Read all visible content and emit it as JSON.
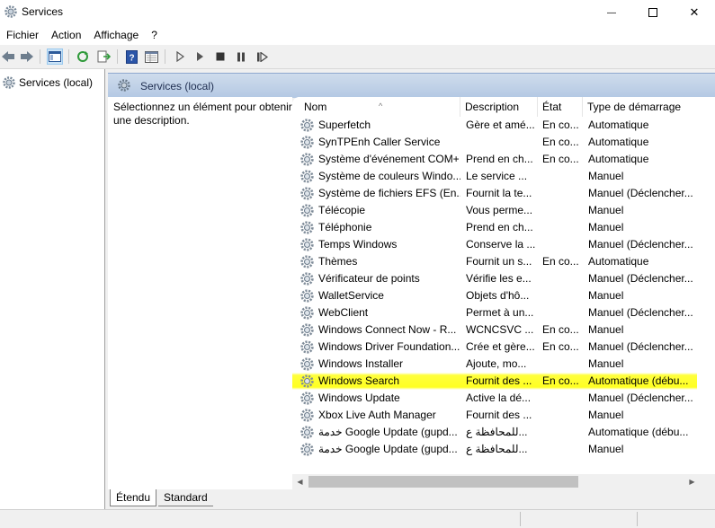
{
  "window": {
    "title": "Services",
    "minimize_glyph": "—",
    "close_glyph": "✕"
  },
  "menu": {
    "items": [
      "Fichier",
      "Action",
      "Affichage",
      "?"
    ]
  },
  "tree": {
    "root_label": "Services (local)"
  },
  "pane": {
    "header_title": "Services (local)",
    "description": "Sélectionnez un élément pour obtenir une description."
  },
  "columns": {
    "name": "Nom",
    "description": "Description",
    "state": "État",
    "startup": "Type de démarrage"
  },
  "services": [
    {
      "name": "Superfetch",
      "description": "Gère et amé...",
      "state": "En co...",
      "startup": "Automatique"
    },
    {
      "name": "SynTPEnh Caller Service",
      "description": "",
      "state": "En co...",
      "startup": "Automatique"
    },
    {
      "name": "Système d'événement COM+",
      "description": "Prend en ch...",
      "state": "En co...",
      "startup": "Automatique"
    },
    {
      "name": "Système de couleurs Windo...",
      "description": "Le service ...",
      "state": "",
      "startup": "Manuel"
    },
    {
      "name": "Système de fichiers EFS (En...",
      "description": "Fournit la te...",
      "state": "",
      "startup": "Manuel (Déclencher..."
    },
    {
      "name": "Télécopie",
      "description": "Vous perme...",
      "state": "",
      "startup": "Manuel"
    },
    {
      "name": "Téléphonie",
      "description": "Prend en ch...",
      "state": "",
      "startup": "Manuel"
    },
    {
      "name": "Temps Windows",
      "description": "Conserve la ...",
      "state": "",
      "startup": "Manuel (Déclencher..."
    },
    {
      "name": "Thèmes",
      "description": "Fournit un s...",
      "state": "En co...",
      "startup": "Automatique"
    },
    {
      "name": "Vérificateur de points",
      "description": "Vérifie les e...",
      "state": "",
      "startup": "Manuel (Déclencher..."
    },
    {
      "name": "WalletService",
      "description": "Objets d'hô...",
      "state": "",
      "startup": "Manuel"
    },
    {
      "name": "WebClient",
      "description": "Permet à un...",
      "state": "",
      "startup": "Manuel (Déclencher..."
    },
    {
      "name": "Windows Connect Now - R...",
      "description": "WCNCSVC ...",
      "state": "En co...",
      "startup": "Manuel"
    },
    {
      "name": "Windows Driver Foundation...",
      "description": "Crée et gère...",
      "state": "En co...",
      "startup": "Manuel (Déclencher..."
    },
    {
      "name": "Windows Installer",
      "description": "Ajoute, mo...",
      "state": "",
      "startup": "Manuel"
    },
    {
      "name": "Windows Search",
      "description": "Fournit des ...",
      "state": "En co...",
      "startup": "Automatique (débu...",
      "highlighted": true
    },
    {
      "name": "Windows Update",
      "description": "Active la dé...",
      "state": "",
      "startup": "Manuel (Déclencher..."
    },
    {
      "name": "Xbox Live Auth Manager",
      "description": "Fournit des ...",
      "state": "",
      "startup": "Manuel"
    },
    {
      "name": "خدمة Google Update (gupd...",
      "description": "للمحافظة ع...",
      "state": "",
      "startup": "Automatique (débu..."
    },
    {
      "name": "خدمة Google Update (gupd...",
      "description": "للمحافظة ع...",
      "state": "",
      "startup": "Manuel"
    }
  ],
  "tabs": [
    {
      "label": "Étendu",
      "active": true
    },
    {
      "label": "Standard",
      "active": false
    }
  ],
  "colors": {
    "highlight": "#ffff22",
    "pane_header": "#b3c8e3"
  }
}
